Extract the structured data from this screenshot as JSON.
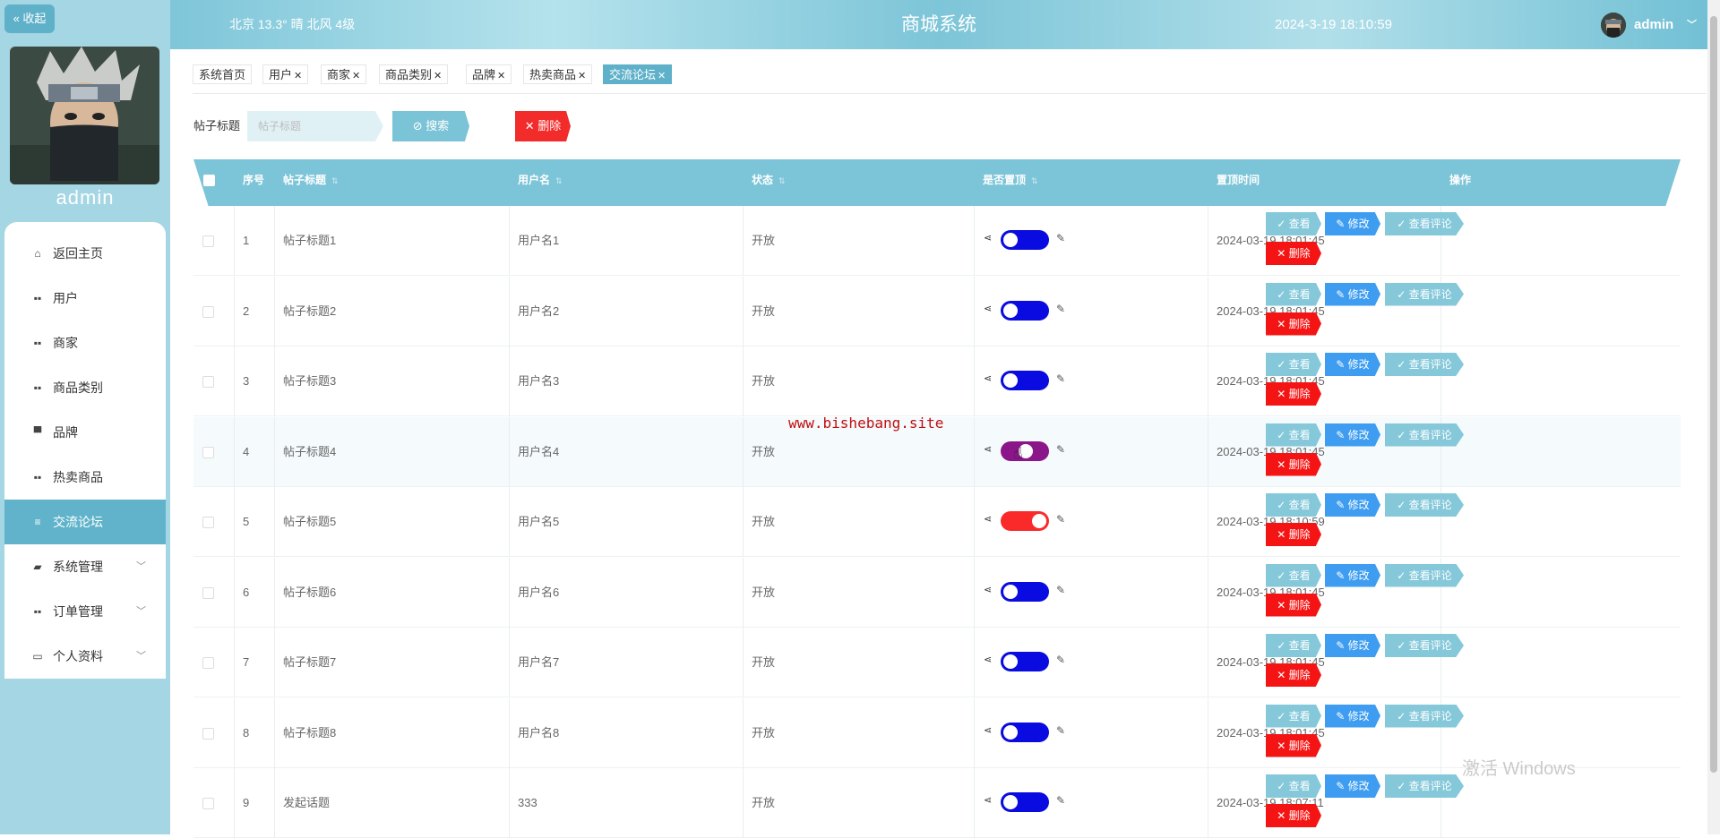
{
  "sidebar": {
    "collapse_label": "« 收起",
    "username": "admin",
    "menu": [
      {
        "icon": "home-icon",
        "glyph": "⌂",
        "label": "返回主页"
      },
      {
        "icon": "grid-icon",
        "glyph": "▪▪",
        "label": "用户"
      },
      {
        "icon": "grid-icon",
        "glyph": "▪▪",
        "label": "商家"
      },
      {
        "icon": "grid-icon",
        "glyph": "▪▪",
        "label": "商品类别"
      },
      {
        "icon": "monitor-icon",
        "glyph": "▀",
        "label": "品牌"
      },
      {
        "icon": "grid-icon",
        "glyph": "▪▪",
        "label": "热卖商品"
      },
      {
        "icon": "list-icon",
        "glyph": "≡",
        "label": "交流论坛",
        "active": true
      },
      {
        "icon": "wallet-icon",
        "glyph": "▰",
        "label": "系统管理",
        "chevron": "﹀"
      },
      {
        "icon": "grid-icon",
        "glyph": "▪▪",
        "label": "订单管理",
        "chevron": "﹀"
      },
      {
        "icon": "card-icon",
        "glyph": "▭",
        "label": "个人资料",
        "chevron": "﹀"
      }
    ]
  },
  "header": {
    "weather": "北京  13.3°  晴  北风  4级",
    "title": "商城系统",
    "datetime": "2024-3-19 18:10:59",
    "user": "admin",
    "chevron": "﹀"
  },
  "tabs": [
    {
      "label": "系统首页",
      "closable": false
    },
    {
      "label": "用户",
      "closable": true
    },
    {
      "label": "商家",
      "closable": true
    },
    {
      "label": "商品类别",
      "closable": true
    },
    {
      "label": "品牌",
      "closable": true
    },
    {
      "label": "热卖商品",
      "closable": true
    },
    {
      "label": "交流论坛",
      "closable": true,
      "active": true
    }
  ],
  "search": {
    "label": "帖子标题",
    "placeholder": "帖子标题",
    "search_label": "⊘ 搜索",
    "delete_label": "✕ 删除"
  },
  "table": {
    "columns": [
      {
        "label": "序号",
        "sortable": false
      },
      {
        "label": "帖子标题",
        "sortable": true
      },
      {
        "label": "用户名",
        "sortable": true
      },
      {
        "label": "状态",
        "sortable": true
      },
      {
        "label": "是否置顶",
        "sortable": true
      },
      {
        "label": "置顶时间",
        "sortable": false
      },
      {
        "label": "操作",
        "sortable": false
      }
    ],
    "sort_glyph": "⇅",
    "actions": {
      "view": "✓ 查看",
      "edit": "✎ 修改",
      "comment": "✓ 查看评论",
      "delete": "✕ 删除"
    },
    "rows": [
      {
        "no": "1",
        "title": "帖子标题1",
        "user": "用户名1",
        "status": "开放",
        "pinned": "off",
        "time": "2024-03-19 18:01:45"
      },
      {
        "no": "2",
        "title": "帖子标题2",
        "user": "用户名2",
        "status": "开放",
        "pinned": "off",
        "time": "2024-03-19 18:01:45"
      },
      {
        "no": "3",
        "title": "帖子标题3",
        "user": "用户名3",
        "status": "开放",
        "pinned": "off",
        "time": "2024-03-19 18:01:45"
      },
      {
        "no": "4",
        "title": "帖子标题4",
        "user": "用户名4",
        "status": "开放",
        "pinned": "hover",
        "time": "2024-03-19 18:01:45",
        "hover": true
      },
      {
        "no": "5",
        "title": "帖子标题5",
        "user": "用户名5",
        "status": "开放",
        "pinned": "on",
        "time": "2024-03-19 18:10:59"
      },
      {
        "no": "6",
        "title": "帖子标题6",
        "user": "用户名6",
        "status": "开放",
        "pinned": "off",
        "time": "2024-03-19 18:01:45"
      },
      {
        "no": "7",
        "title": "帖子标题7",
        "user": "用户名7",
        "status": "开放",
        "pinned": "off",
        "time": "2024-03-19 18:01:45"
      },
      {
        "no": "8",
        "title": "帖子标题8",
        "user": "用户名8",
        "status": "开放",
        "pinned": "off",
        "time": "2024-03-19 18:01:45"
      },
      {
        "no": "9",
        "title": "发起话题",
        "user": "333",
        "status": "开放",
        "pinned": "off",
        "time": "2024-03-19 18:07:11"
      }
    ]
  },
  "overlay": {
    "site_watermark": "www.bishebang.site",
    "windows_watermark": "激活 Windows"
  },
  "colors": {
    "accent": "#5fb1c9",
    "table_header": "#7cc4d7",
    "danger": "#f22b2b",
    "edit": "#3e9df1",
    "toggle_off": "#0a0be0",
    "toggle_on": "#fa2a2a"
  }
}
